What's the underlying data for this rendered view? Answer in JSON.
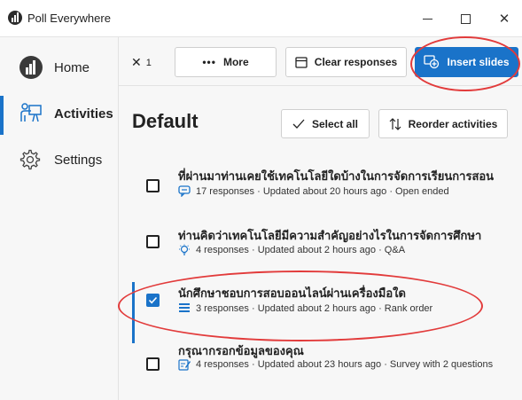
{
  "window": {
    "title": "Poll Everywhere",
    "minimize_icon": "minimize-icon",
    "maximize_icon": "maximize-icon",
    "close_glyph": "✕"
  },
  "sidebar": {
    "items": [
      {
        "label": "Home",
        "icon": "poll-everywhere-logo-icon",
        "active": false
      },
      {
        "label": "Activities",
        "icon": "presentation-icon",
        "active": true
      },
      {
        "label": "Settings",
        "icon": "gear-icon",
        "active": false
      }
    ]
  },
  "toolbar": {
    "close_glyph": "✕",
    "selected_count": "1",
    "more_label": "More",
    "clear_label": "Clear responses",
    "insert_label": "Insert slides"
  },
  "main": {
    "heading": "Default",
    "select_all_label": "Select all",
    "reorder_label": "Reorder activities"
  },
  "activities": [
    {
      "title": "ที่ผ่านมาท่านเคยใช้เทคโนโลยีใดบ้างในการจัดการเรียนการสอน",
      "meta": "17 responses · Updated about 20 hours ago · Open ended",
      "icon": "speech-bubble-icon",
      "checked": false
    },
    {
      "title": "ท่านคิดว่าเทคโนโลยีมีความสำคัญอย่างไรในการจัดการศึกษา",
      "meta": "4 responses · Updated about 2 hours ago · Q&A",
      "icon": "lightbulb-icon",
      "checked": false
    },
    {
      "title": "นักศึกษาชอบการสอบออนไลน์ผ่านเครื่องมือใด",
      "meta": "3 responses · Updated about 2 hours ago · Rank order",
      "icon": "list-icon",
      "checked": true
    },
    {
      "title": "กรุณากรอกข้อมูลของคุณ",
      "meta": "4 responses · Updated about 23 hours ago · Survey with 2 questions",
      "icon": "survey-icon",
      "checked": false
    }
  ],
  "colors": {
    "accent": "#1a73c9",
    "annotation": "#e23b3b"
  }
}
